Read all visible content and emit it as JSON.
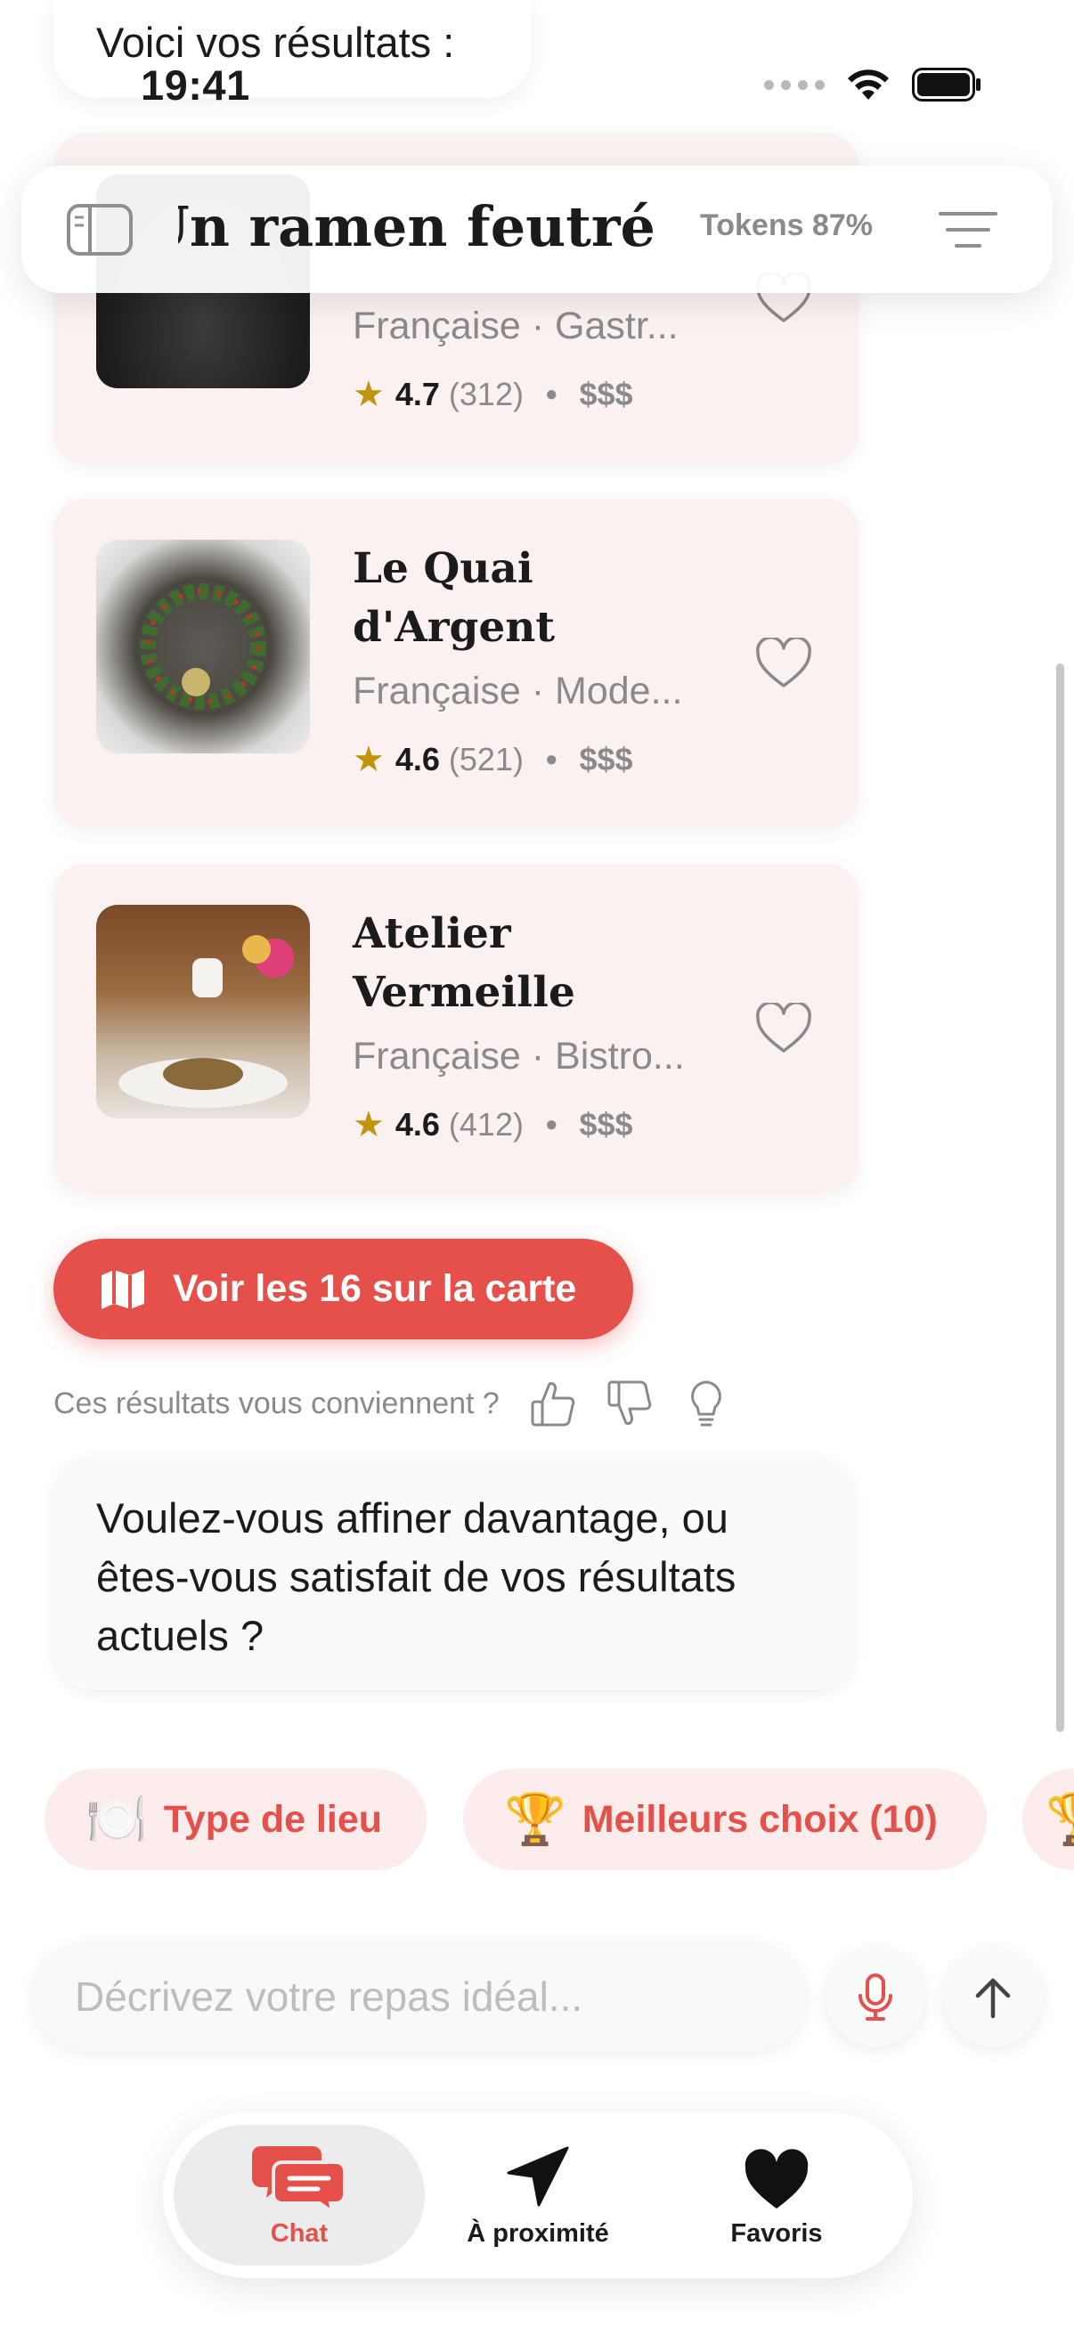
{
  "status_bar": {
    "time": "19:41"
  },
  "chat": {
    "top_message": "Voici vos résultats :",
    "assistant_question": "Voulez-vous affiner davantage, ou êtes-vous satisfait de vos résultats actuels ?",
    "feedback_prompt": "Ces résultats vous conviennent ?"
  },
  "header": {
    "title": "Un ramen feutré",
    "tokens": "Tokens 87%"
  },
  "restaurants": [
    {
      "name": "",
      "cuisine": "Française · Gastr...",
      "rating": "4.7",
      "reviews": "(312)",
      "price": "$$$"
    },
    {
      "name": "Le Quai d'Argent",
      "cuisine": "Française · Mode...",
      "rating": "4.6",
      "reviews": "(521)",
      "price": "$$$"
    },
    {
      "name": "Atelier Vermeille",
      "cuisine": "Française · Bistro...",
      "rating": "4.6",
      "reviews": "(412)",
      "price": "$$$"
    }
  ],
  "map_button": {
    "label": "Voir les 16 sur la carte"
  },
  "chips": [
    {
      "emoji": "🍽️",
      "label": "Type de lieu"
    },
    {
      "emoji": "🏆",
      "label": "Meilleurs choix (10)"
    },
    {
      "emoji": "🏆",
      "label": ""
    }
  ],
  "composer": {
    "placeholder": "Décrivez votre repas idéal..."
  },
  "tabbar": {
    "chat": "Chat",
    "nearby": "À proximité",
    "favorites": "Favoris"
  },
  "colors": {
    "accent": "#e5504b",
    "card_bg": "#fcf1f1",
    "chip_bg": "#fcecec",
    "star": "#c0950d",
    "muted_text": "#8a8a8a"
  },
  "icons": [
    "sidebar-icon",
    "menu-lines-icon",
    "heart-icon",
    "star-icon",
    "map-icon",
    "thumbs-up-icon",
    "thumbs-down-icon",
    "lightbulb-icon",
    "microphone-icon",
    "arrow-up-icon",
    "chat-bubbles-icon",
    "location-arrow-icon",
    "heart-filled-icon"
  ]
}
